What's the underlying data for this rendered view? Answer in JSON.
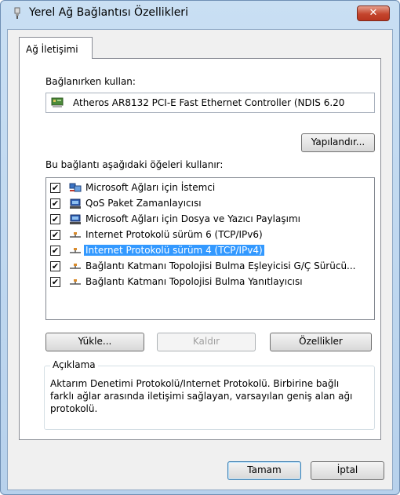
{
  "window": {
    "title": "Yerel Ağ Bağlantısı Özellikleri",
    "close_label": "✕"
  },
  "tabs": [
    {
      "label": "Ağ İletişimi"
    }
  ],
  "connect_using": {
    "label": "Bağlanırken kullan:",
    "adapter": "Atheros AR8132 PCI-E Fast Ethernet Controller (NDIS 6.20",
    "configure_button": "Yapılandır..."
  },
  "items_section": {
    "label": "Bu bağlantı aşağıdaki öğeleri kullanır:",
    "items": [
      {
        "label": "Microsoft Ağları için İstemci",
        "checked": "✔",
        "icon": "network-client-icon"
      },
      {
        "label": "QoS Paket Zamanlayıcısı",
        "checked": "✔",
        "icon": "computer-icon"
      },
      {
        "label": "Microsoft Ağları için Dosya ve Yazıcı Paylaşımı",
        "checked": "✔",
        "icon": "computer-icon"
      },
      {
        "label": "Internet Protokolü sürüm 6 (TCP/IPv6)",
        "checked": "✔",
        "icon": "protocol-icon"
      },
      {
        "label": "Internet Protokolü sürüm 4 (TCP/IPv4)",
        "checked": "✔",
        "icon": "protocol-icon",
        "selected": true
      },
      {
        "label": "Bağlantı Katmanı Topolojisi Bulma Eşleyicisi G/Ç Sürücü...",
        "checked": "✔",
        "icon": "protocol-icon"
      },
      {
        "label": "Bağlantı Katmanı Topolojisi Bulma Yanıtlayıcısı",
        "checked": "✔",
        "icon": "protocol-icon"
      }
    ]
  },
  "buttons": {
    "install": "Yükle...",
    "uninstall": "Kaldır",
    "properties": "Özellikler",
    "ok": "Tamam",
    "cancel": "İptal"
  },
  "description": {
    "title": "Açıklama",
    "text": "Aktarım Denetimi Protokolü/Internet Protokolü. Birbirine bağlı farklı ağlar arasında iletişimi sağlayan, varsayılan geniş alan ağı protokolü."
  },
  "colors": {
    "selection": "#3399ff",
    "close_button": "#c4452d",
    "title_bar": "#b9d1ea"
  }
}
